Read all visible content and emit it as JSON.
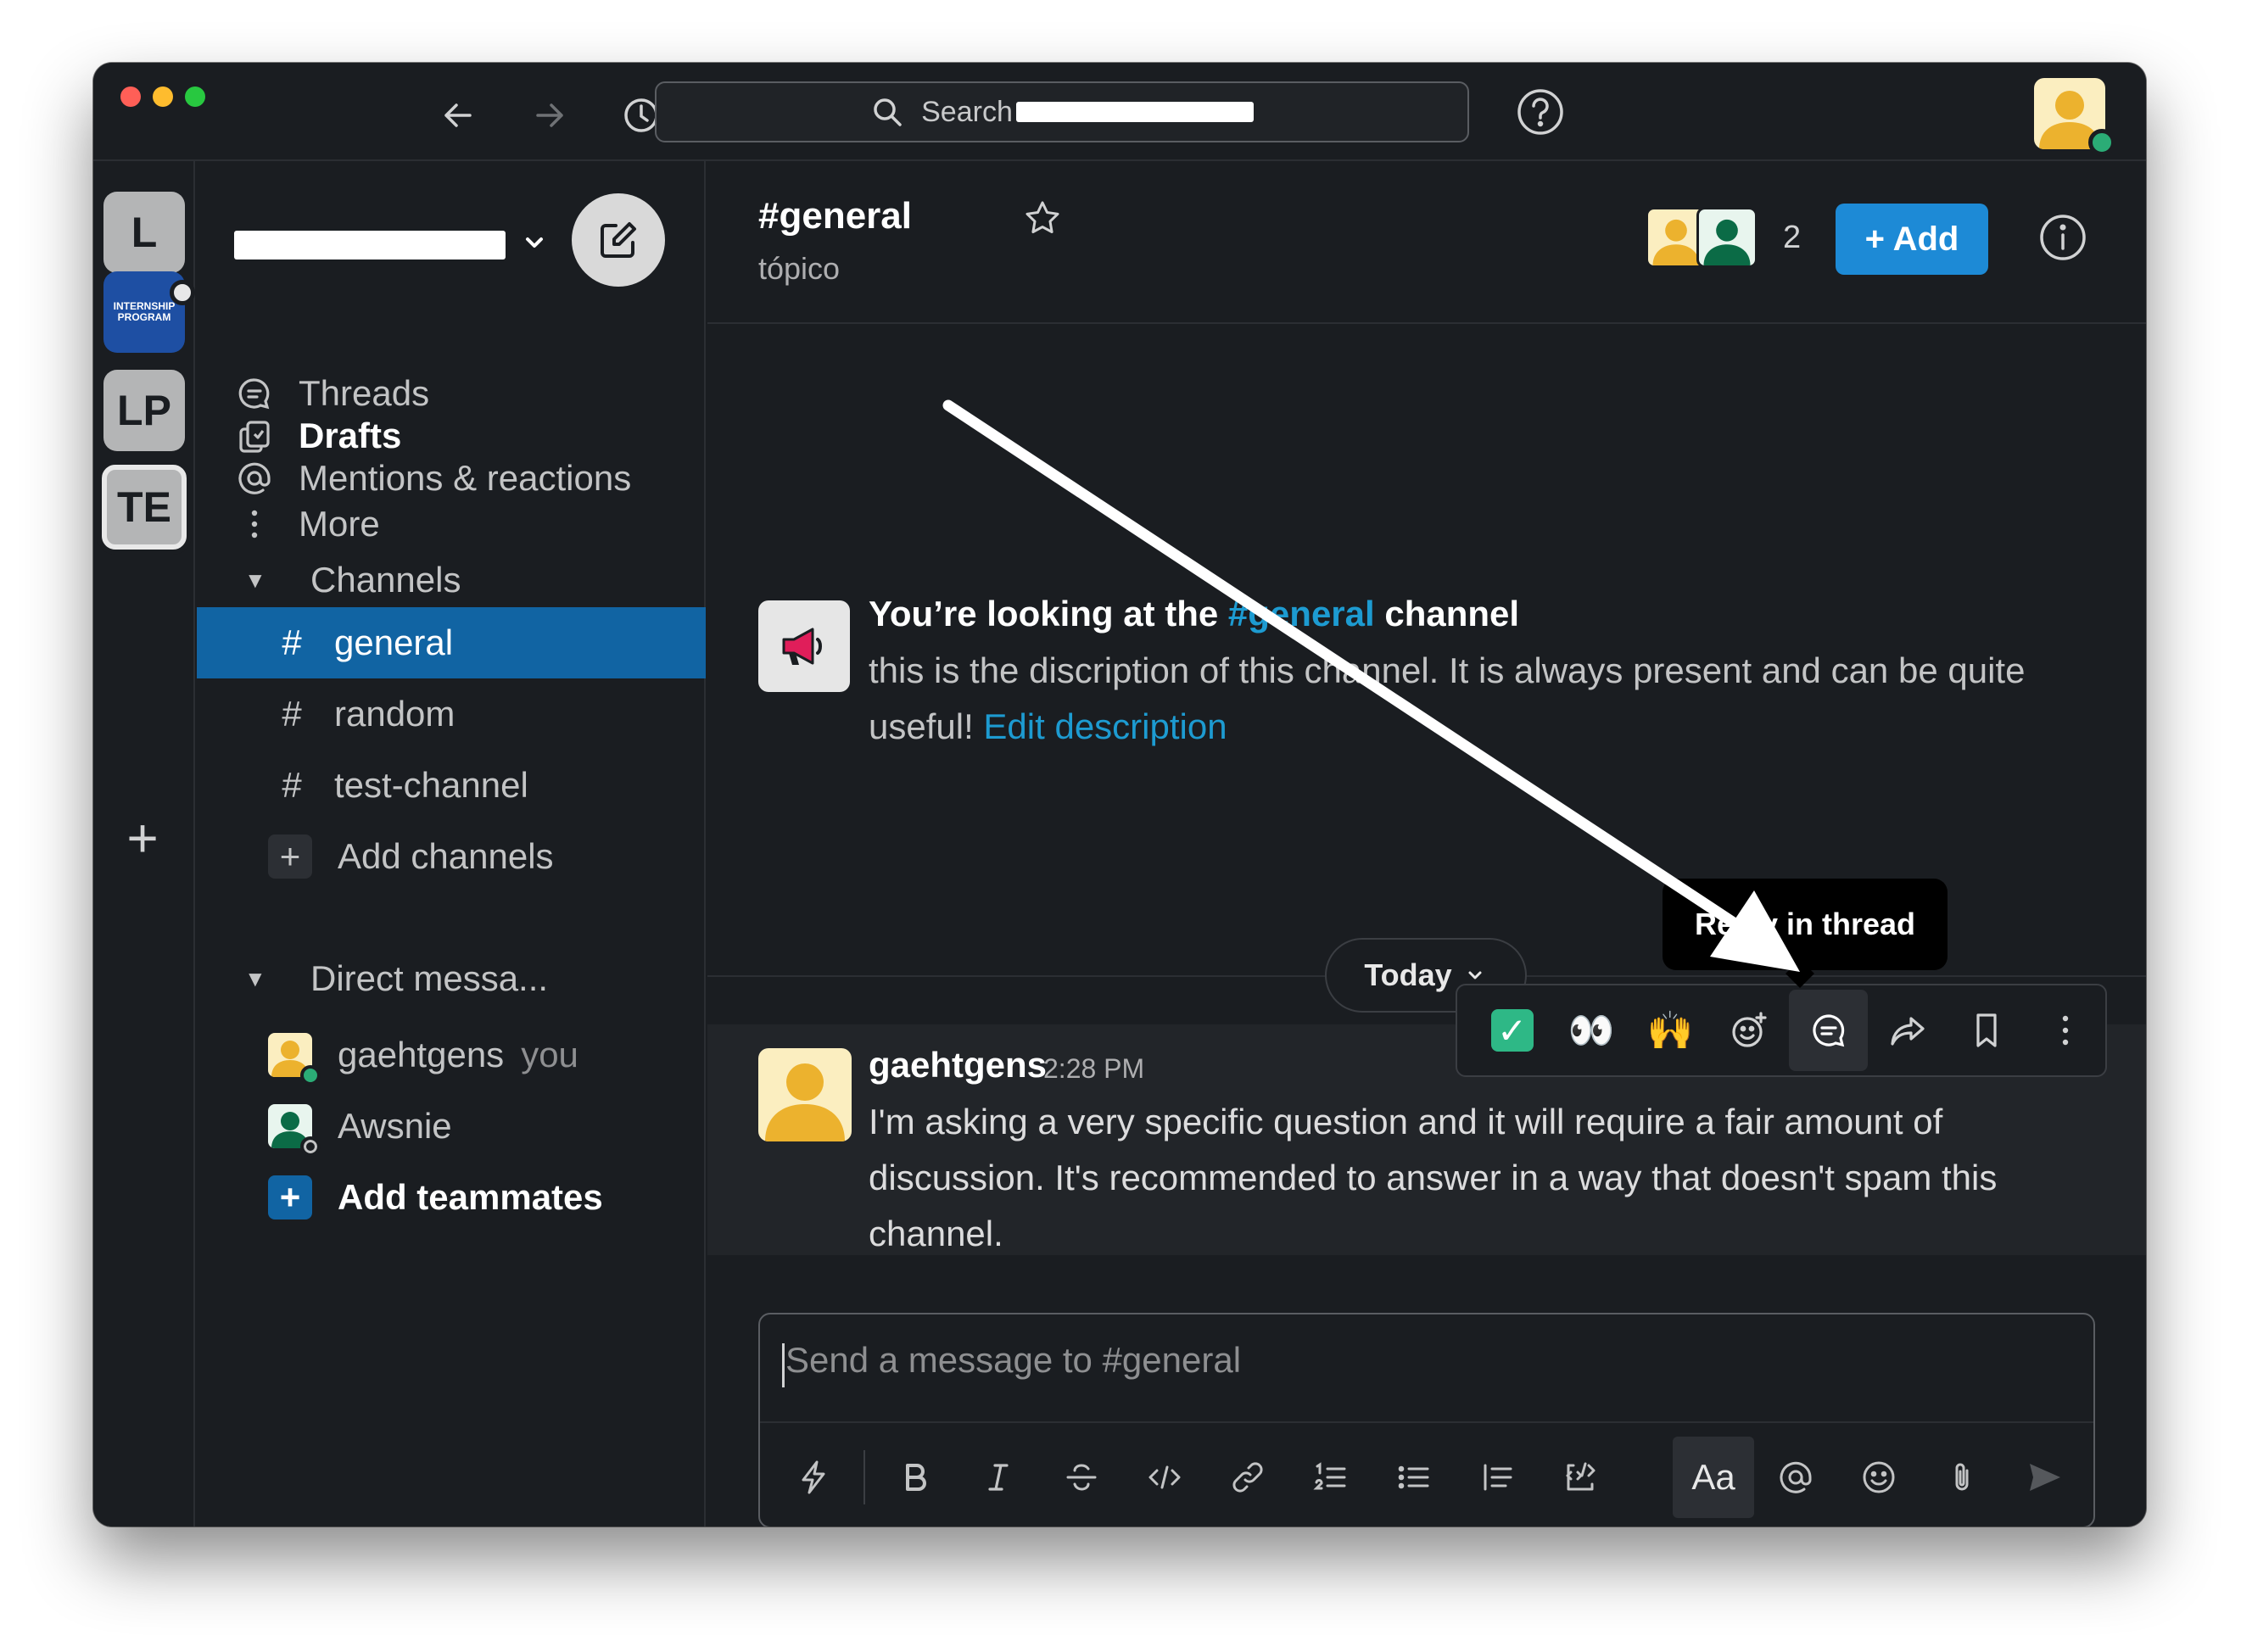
{
  "titlebar": {
    "search_label": "Search",
    "help_icon": "help-icon"
  },
  "rail": {
    "workspaces": [
      {
        "label": "L"
      },
      {
        "label": "INTERNSHIP PROGRAM"
      },
      {
        "label": "LP"
      },
      {
        "label": "TE"
      }
    ]
  },
  "sidebar": {
    "nav": [
      {
        "label": "Threads",
        "icon": "threads-icon"
      },
      {
        "label": "Drafts",
        "icon": "drafts-icon"
      },
      {
        "label": "Mentions & reactions",
        "icon": "at-icon"
      },
      {
        "label": "More",
        "icon": "more-vertical-icon"
      }
    ],
    "channels_header": "Channels",
    "channels": [
      {
        "hash": "#",
        "name": "general",
        "active": true
      },
      {
        "hash": "#",
        "name": "random"
      },
      {
        "hash": "#",
        "name": "test-channel"
      }
    ],
    "add_channels": "Add channels",
    "dm_header": "Direct messa...",
    "dms": [
      {
        "name": "gaehtgens",
        "suffix": "you",
        "status_color": "#2bac76"
      },
      {
        "name": "Awsnie",
        "suffix": "",
        "status_color": "#1a1d21"
      }
    ],
    "add_teammates": "Add teammates"
  },
  "channel": {
    "title": "#general",
    "topic": "tópico",
    "member_count": "2",
    "add_label": "+ Add"
  },
  "intro": {
    "prefix": "You’re looking at the ",
    "channel_link": "#general",
    "suffix": " channel",
    "description": "this is the discription of this channel. It is always present and can be quite useful! ",
    "edit_link": "Edit description"
  },
  "divider": {
    "label": "Today"
  },
  "message": {
    "author": "gaehtgens",
    "time": "2:28 PM",
    "text": "I'm asking a very specific question and it will require a fair amount of discussion. It's recommended to answer in a way that doesn't spam  this channel."
  },
  "message_actions": {
    "emoji_check": "✓",
    "emoji_eyes": "👀",
    "emoji_raised_hands": "🙌",
    "tooltip": "Reply in thread"
  },
  "composer": {
    "placeholder": "Send a message to #general",
    "format_label": "Aa"
  },
  "colors": {
    "background": "#1a1d21",
    "active_channel": "#1164a3",
    "accent_button": "#1d8ad6",
    "link": "#1d9bd1",
    "online": "#2bac76"
  }
}
